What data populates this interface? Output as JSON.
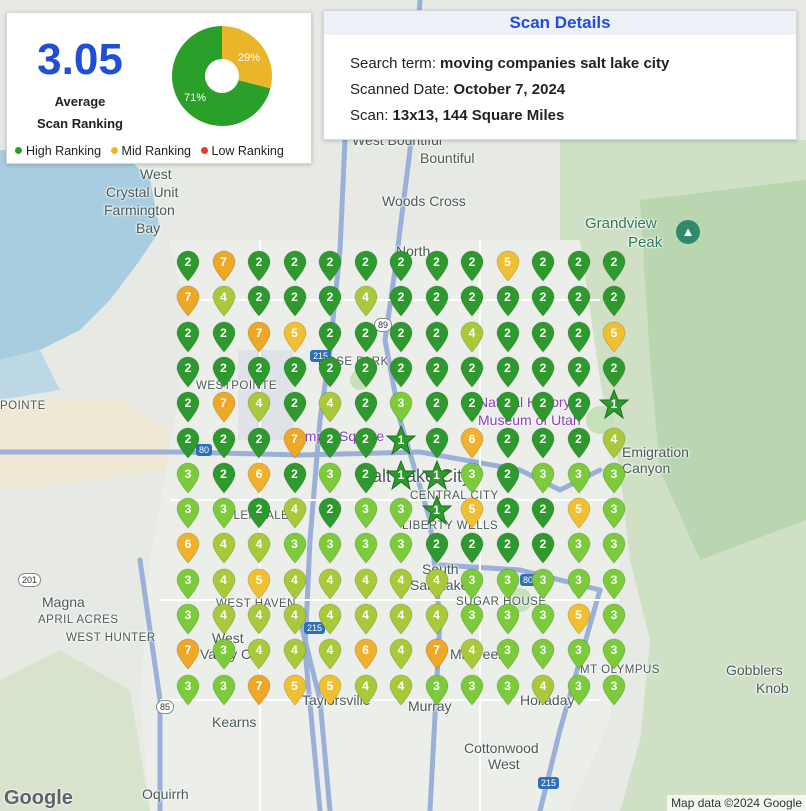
{
  "summary": {
    "average_value": "3.05",
    "average_label_line1": "Average",
    "average_label_line2": "Scan Ranking",
    "donut": [
      {
        "label": "29%",
        "fraction": 0.29,
        "color": "#eab52a"
      },
      {
        "label": "71%",
        "fraction": 0.71,
        "color": "#2aa02a"
      }
    ],
    "legend": [
      {
        "label": "High Ranking",
        "color": "#2aa02a"
      },
      {
        "label": "Mid Ranking",
        "color": "#eab52a"
      },
      {
        "label": "Low Ranking",
        "color": "#e53b2c"
      }
    ]
  },
  "details": {
    "title": "Scan Details",
    "search_term_label": "Search term: ",
    "search_term_value": "moving companies salt lake city",
    "scanned_date_label": "Scanned Date: ",
    "scanned_date_value": "October 7, 2024",
    "scan_label": "Scan: ",
    "scan_value": "13x13, 144 Square Miles"
  },
  "map_labels": {
    "west": "West",
    "crystal_unit": "Crystal Unit",
    "farmington_bay": "Farmington",
    "bay": "Bay",
    "bountiful_west": "West Bountiful",
    "bountiful": "Bountiful",
    "woods_cross": "Woods Cross",
    "grandview": "Grandview",
    "peak": "Peak",
    "north": "North",
    "north_salt_lake": "Salt Lake",
    "westpointe": "WESTPOINTE",
    "rose_park": "ROSE PARK",
    "pointe": "POINTE",
    "museum": "Natural History",
    "museum2": "Museum of Utah",
    "temple_square": "Temple Square",
    "emigration": "Emigration",
    "canyon": "Canyon",
    "salt_lake_city": "Salt Lake City",
    "central_city": "CENTRAL CITY",
    "liberty_wells": "LIBERTY WELLS",
    "glendale": "GLENDALE",
    "south_salt_lake": "South",
    "south_salt_lake2": "Salt Lake",
    "sugar_house": "SUGAR HOUSE",
    "magna": "Magna",
    "april_acres": "APRIL ACRES",
    "west_hunter": "WEST HUNTER",
    "west_haven": "WEST HAVEN",
    "west_valley": "West",
    "west_valley2": "Valley City",
    "millcreek": "Millcreek",
    "mt_olympus": "MT OLYMPUS",
    "gobblers": "Gobblers",
    "knob": "Knob",
    "taylorsville": "Taylorsville",
    "murray": "Murray",
    "holladay": "Holladay",
    "kearns": "Kearns",
    "cottonwood": "Cottonwood",
    "cottonwood2": "West",
    "oquirrh": "Oquirrh"
  },
  "shields": [
    "89",
    "215",
    "80",
    "201",
    "85",
    "215",
    "215",
    "80",
    "89"
  ],
  "grid": {
    "rows": [
      [
        "2",
        "7",
        "2",
        "2",
        "2",
        "2",
        "2",
        "2",
        "2",
        "5",
        "2",
        "2",
        "2"
      ],
      [
        "7",
        "4",
        "2",
        "2",
        "2",
        "4",
        "2",
        "2",
        "2",
        "2",
        "2",
        "2",
        "2"
      ],
      [
        "2",
        "2",
        "7",
        "5",
        "2",
        "2",
        "2",
        "2",
        "4",
        "2",
        "2",
        "2",
        "5"
      ],
      [
        "2",
        "2",
        "2",
        "2",
        "2",
        "2",
        "2",
        "2",
        "2",
        "2",
        "2",
        "2",
        "2"
      ],
      [
        "2",
        "7",
        "4",
        "2",
        "4",
        "2",
        "3",
        "2",
        "2",
        "2",
        "2",
        "2",
        "1"
      ],
      [
        "2",
        "2",
        "2",
        "7",
        "2",
        "2",
        "1",
        "2",
        "6",
        "2",
        "2",
        "2",
        "4"
      ],
      [
        "3",
        "2",
        "6",
        "2",
        "3",
        "2",
        "1",
        "1",
        "3",
        "2",
        "3",
        "3",
        "3"
      ],
      [
        "3",
        "3",
        "2",
        "4",
        "2",
        "3",
        "3",
        "1",
        "5",
        "2",
        "2",
        "5",
        "3"
      ],
      [
        "6",
        "4",
        "4",
        "3",
        "3",
        "3",
        "3",
        "2",
        "2",
        "2",
        "2",
        "3",
        "3"
      ],
      [
        "3",
        "4",
        "5",
        "4",
        "4",
        "4",
        "4",
        "4",
        "3",
        "3",
        "3",
        "3",
        "3"
      ],
      [
        "3",
        "4",
        "4",
        "4",
        "4",
        "4",
        "4",
        "4",
        "3",
        "3",
        "3",
        "5",
        "3"
      ],
      [
        "7",
        "3",
        "4",
        "4",
        "4",
        "6",
        "4",
        "7",
        "4",
        "3",
        "3",
        "3",
        "3"
      ],
      [
        "3",
        "3",
        "7",
        "5",
        "5",
        "4",
        "4",
        "3",
        "3",
        "3",
        "4",
        "3",
        "3"
      ]
    ],
    "stars": [
      [
        4,
        12
      ],
      [
        5,
        6
      ],
      [
        6,
        6
      ],
      [
        6,
        7
      ],
      [
        7,
        7
      ]
    ],
    "colors": {
      "1": "#2e9a2e",
      "2": "#2e9a2e",
      "3": "#7ccb3a",
      "4": "#a7c93a",
      "5": "#f0c030",
      "6": "#f0b22c",
      "7": "#eea826"
    }
  },
  "footer": {
    "google": "Google",
    "attribution": "Map data ©2024 Google"
  }
}
